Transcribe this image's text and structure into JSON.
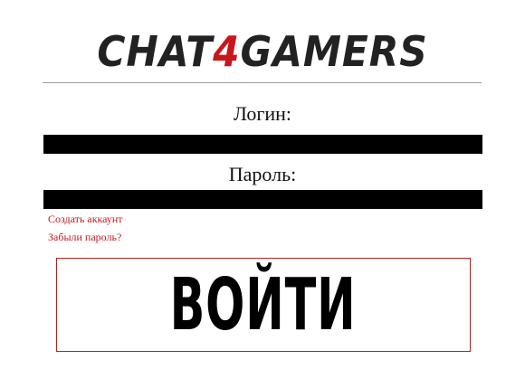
{
  "header": {
    "logo_part1": "CHAT",
    "logo_accent": "4",
    "logo_part2": "GAMERS"
  },
  "form": {
    "login_label": "Логин:",
    "login_value": "",
    "password_label": "Пароль:",
    "password_value": "",
    "create_account_link": "Создать аккаунт",
    "forgot_password_link": "Забыли пароль?",
    "submit_label": "ВОЙТИ"
  },
  "colors": {
    "accent": "#c8171c",
    "logo_dark": "#222222",
    "input_background": "#000000",
    "button_border": "#b32020"
  }
}
